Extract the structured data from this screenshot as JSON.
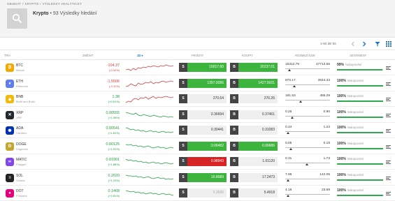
{
  "breadcrumb": [
    "OBJEVIT",
    "/",
    "KRYPTO",
    "/",
    "VÝSLEDKY ANALÝTICKÝ"
  ],
  "header": {
    "title": "Krypto",
    "subtitle": "• 93 Výsledky hledání"
  },
  "toolbar": {
    "pagination": "1-50 ZE 93"
  },
  "columns": {
    "trh": "TRH",
    "zmenit": "ZMĚNIT",
    "period": "1D",
    "prodat": "PRODAT",
    "koupit": "KOUPIT",
    "rozmezi": "ROZMEZÍ 52W",
    "sentiment": "SENTIMENT"
  },
  "colors": {
    "green": "#3db43d",
    "red": "#d62424",
    "pos": "#1e9e3a",
    "neg": "#d03b3b"
  },
  "rows": [
    {
      "symbol": "BTC",
      "name": "Bitcoin",
      "change": "-104.37",
      "pct": "(-0.52%)",
      "dir": "neg",
      "sell": "19917.60",
      "buy": "20237.01",
      "sell_style": "g",
      "buy_style": "g",
      "low": "15312.76",
      "high": "47713.56",
      "range_pos": 0.1,
      "sent_pct": "99%",
      "sent_label": "Nakupování",
      "sent_val": 0.99,
      "logo_color": "#f2a900",
      "logo": "₿",
      "spark": [
        6,
        7,
        5,
        8,
        6,
        9,
        8,
        10,
        9,
        11,
        10,
        12,
        11,
        10,
        12,
        11,
        13,
        12,
        11,
        12
      ],
      "spark_dir": "neg"
    },
    {
      "symbol": "ETH",
      "name": "Ethereum",
      "change": "-1.5506",
      "pct": "(-0.11%)",
      "dir": "neg",
      "sell": "1397.9286",
      "buy": "1427.5031",
      "sell_style": "g",
      "buy_style": "g",
      "low": "870.17",
      "high": "3544.43",
      "range_pos": 0.2,
      "sent_pct": "100%",
      "sent_label": "Nakupování",
      "sent_val": 1,
      "logo_color": "#627eea",
      "logo": "♦",
      "spark": [
        5,
        6,
        9,
        7,
        6,
        10,
        8,
        9,
        11,
        10,
        12,
        9,
        11,
        10,
        12,
        13,
        11,
        12,
        13,
        12
      ],
      "spark_dir": "neg"
    },
    {
      "symbol": "BNB",
      "name": "Build and Build",
      "change": "1.38",
      "pct": "(+0.51%)",
      "dir": "pos",
      "sell": "270.64",
      "buy": "276.26",
      "sell_style": "",
      "buy_style": "",
      "low": "181.53",
      "high": "455.29",
      "range_pos": 0.34,
      "sent_pct": "100%",
      "sent_label": "Nakupování",
      "sent_val": 1,
      "logo_color": "#f0b90b",
      "logo": "◆",
      "spark": [
        4,
        6,
        5,
        9,
        10,
        8,
        11,
        10,
        12,
        9,
        11,
        13,
        10,
        12,
        11,
        12,
        13,
        12,
        11,
        12
      ],
      "spark_dir": "neg"
    },
    {
      "symbol": "XRP",
      "name": "XRP",
      "change": "0.00555",
      "pct": "(+1.56%)",
      "dir": "pos",
      "sell": "0.36694",
      "buy": "0.37461",
      "sell_style": "",
      "buy_style": "",
      "low": "0.28",
      "high": "0.90",
      "range_pos": 0.16,
      "sent_pct": "100%",
      "sent_label": "Nakupování",
      "sent_val": 1,
      "logo_color": "#23292f",
      "logo": "✕",
      "spark": [
        13,
        12,
        11,
        10,
        12,
        9,
        8,
        10,
        9,
        8,
        7,
        9,
        8,
        7,
        6,
        8,
        7,
        6,
        7,
        6
      ],
      "spark_dir": "pos"
    },
    {
      "symbol": "ADA",
      "name": "Cardano",
      "change": "0.00541",
      "pct": "(+1.81%)",
      "dir": "pos",
      "sell": "0.30441",
      "buy": "0.31083",
      "sell_style": "",
      "buy_style": "",
      "low": "0.24",
      "high": "1.23",
      "range_pos": 0.07,
      "sent_pct": "100%",
      "sent_label": "Nakupování",
      "sent_val": 1,
      "logo_color": "#0033ad",
      "logo": "✺",
      "spark": [
        13,
        12,
        10,
        11,
        9,
        10,
        8,
        9,
        7,
        8,
        9,
        7,
        8,
        6,
        7,
        8,
        6,
        7,
        6,
        7
      ],
      "spark_dir": "pos"
    },
    {
      "symbol": "DOGE",
      "name": "Dogecoin",
      "change": "0.00125",
      "pct": "(+1.91%)",
      "dir": "pos",
      "sell": "0.06482",
      "buy": "0.06686",
      "sell_style": "g",
      "buy_style": "g",
      "low": "0.05",
      "high": "0.18",
      "range_pos": 0.12,
      "sent_pct": "100%",
      "sent_label": "Nakupování",
      "sent_val": 1,
      "logo_color": "#c2a633",
      "logo": "Ð",
      "spark": [
        12,
        11,
        12,
        10,
        11,
        9,
        10,
        8,
        9,
        10,
        8,
        7,
        8,
        9,
        7,
        8,
        6,
        7,
        8,
        7
      ],
      "spark_dir": "pos"
    },
    {
      "symbol": "MATIC",
      "name": "Polygon",
      "change": "0.01901",
      "pct": "(+1.88%)",
      "dir": "pos",
      "sell": "0.98943",
      "buy": "1.01120",
      "sell_style": "r",
      "buy_style": "",
      "low": "0.31",
      "high": "1.73",
      "range_pos": 0.48,
      "sent_pct": "100%",
      "sent_label": "Nakupování",
      "sent_val": 1,
      "logo_color": "#8247e5",
      "logo": "∞",
      "spark": [
        13,
        11,
        12,
        10,
        11,
        9,
        10,
        8,
        9,
        7,
        8,
        9,
        7,
        8,
        6,
        7,
        8,
        7,
        6,
        7
      ],
      "spark_dir": "pos"
    },
    {
      "symbol": "SOL",
      "name": "Solana",
      "change": "0.2020",
      "pct": "(+1.22%)",
      "dir": "pos",
      "sell": "16.8089",
      "buy": "17.2473",
      "sell_style": "g",
      "buy_style": "",
      "low": "7.96",
      "high": "142.05",
      "range_pos": 0.06,
      "sent_pct": "100%",
      "sent_label": "Nakupování",
      "sent_val": 1,
      "logo_color": "#222222",
      "logo": "≡",
      "spark": [
        13,
        12,
        12,
        11,
        12,
        10,
        11,
        9,
        10,
        11,
        9,
        8,
        9,
        10,
        8,
        9,
        7,
        8,
        7,
        8
      ],
      "spark_dir": "pos"
    },
    {
      "symbol": "DOT",
      "name": "Polkadot",
      "change": "0.1468",
      "pct": "(+2.81%)",
      "dir": "pos",
      "sell": "5.3590",
      "buy": "5.4918",
      "sell_style": "dim",
      "buy_style": "",
      "low": "4.18",
      "high": "23.59",
      "range_pos": 0.07,
      "sent_pct": "100%",
      "sent_label": "Nakupování",
      "sent_val": 1,
      "logo_color": "#e6007a",
      "logo": "●",
      "spark": [
        13,
        12,
        11,
        12,
        10,
        11,
        9,
        10,
        8,
        9,
        10,
        8,
        9,
        7,
        8,
        9,
        7,
        8,
        7,
        6
      ],
      "spark_dir": "pos"
    }
  ]
}
